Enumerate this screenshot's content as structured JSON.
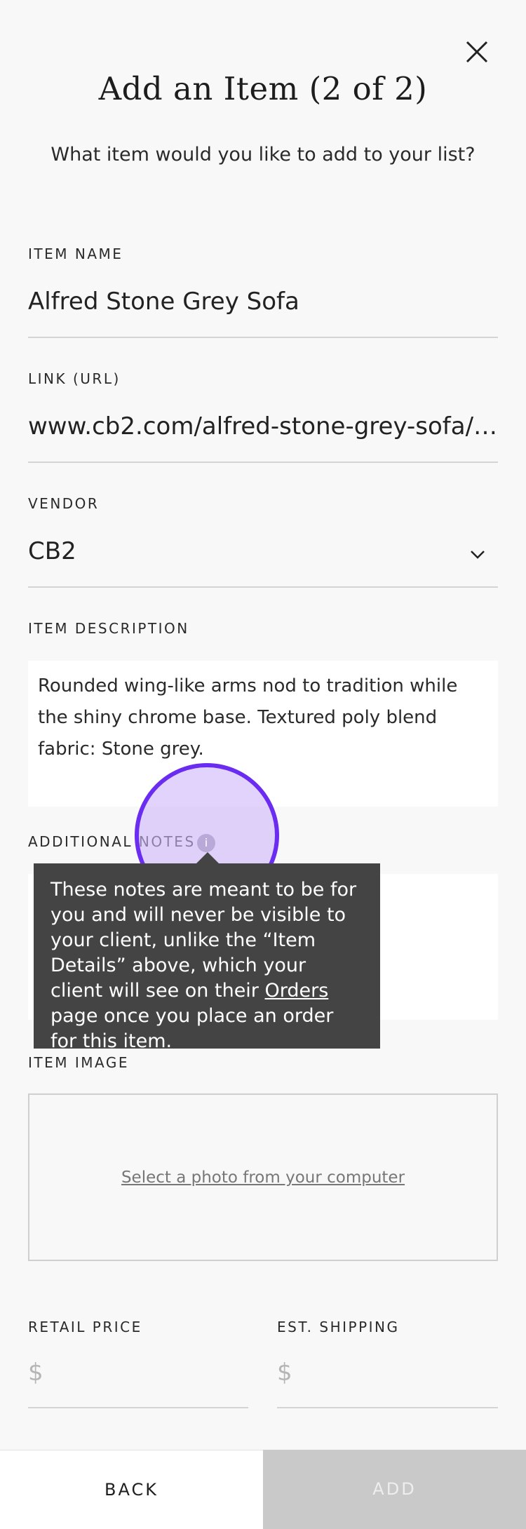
{
  "modal": {
    "title": "Add an Item (2 of 2)",
    "subtitle": "What item would you like to add to your list?"
  },
  "fields": {
    "item_name": {
      "label": "ITEM NAME",
      "value": "Alfred Stone Grey Sofa"
    },
    "link": {
      "label": "LINK (URL)",
      "value": "www.cb2.com/alfred-stone-grey-sofa/s…"
    },
    "vendor": {
      "label": "VENDOR",
      "value": "CB2"
    },
    "description": {
      "label": "ITEM DESCRIPTION",
      "value": "Rounded wing-like arms nod to tradition while the shiny chrome base. Textured poly blend fabric: Stone grey."
    },
    "notes": {
      "label": "ADDITIONAL NOTES",
      "info_icon": "i"
    },
    "image": {
      "label": "ITEM IMAGE",
      "link_text": "Select a photo from your computer"
    },
    "retail_price": {
      "label": "RETAIL PRICE",
      "placeholder": "$"
    },
    "est_shipping": {
      "label": "EST. SHIPPING",
      "placeholder": "$"
    }
  },
  "tooltip": {
    "text_before": "These notes are meant to be for you and will never be visible to your client, unlike the “Item Details” above, which your client will see on their ",
    "link": "Orders",
    "text_after": " page once you place an order for this item."
  },
  "footer": {
    "back_label": "BACK",
    "add_label": "ADD"
  },
  "colors": {
    "highlight_ring": "#6b2cf2",
    "tooltip_bg": "#444444",
    "add_disabled_bg": "#c9c9c9"
  },
  "icons": {
    "close": "close-icon",
    "vendor_dropdown": "chevron-down-icon",
    "notes_info": "info-icon"
  }
}
